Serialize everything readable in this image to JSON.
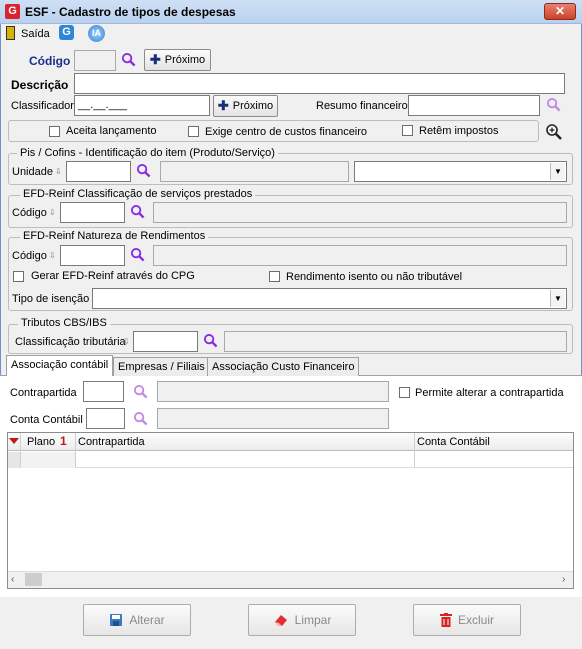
{
  "window": {
    "title": "ESF - Cadastro de tipos de despesas",
    "close": "✕"
  },
  "toolbar": {
    "exit_label": "Saída",
    "ia_label": "IA"
  },
  "form": {
    "codigo_label": "Código",
    "proximo_label": "Próximo",
    "descricao_label": "Descrição",
    "classificador_label": "Classificador",
    "classificador_value": "__.__.___",
    "resumo_label": "Resumo financeiro",
    "aceita_label": "Aceita lançamento",
    "exige_label": "Exige centro de custos financeiro",
    "retem_label": "Retêm impostos"
  },
  "pis": {
    "title": "Pis / Cofins - Identificação do item (Produto/Serviço)",
    "unidade_label": "Unidade"
  },
  "efd_class": {
    "title": "EFD-Reinf Classificação de serviços prestados",
    "codigo_label": "Código"
  },
  "efd_nat": {
    "title": "EFD-Reinf Natureza de Rendimentos",
    "codigo_label": "Código",
    "gerar_label": "Gerar EFD-Reinf através do CPG",
    "isento_label": "Rendimento isento ou não tributável",
    "tipo_label": "Tipo de isenção"
  },
  "cbs": {
    "title": "Tributos CBS/IBS",
    "classificacao_label": "Classificação tributária"
  },
  "tabs": [
    {
      "label": "Associação contábil"
    },
    {
      "label": "Empresas / Filiais"
    },
    {
      "label": "Associação Custo Financeiro"
    }
  ],
  "assoc": {
    "contrapartida_label": "Contrapartida",
    "permite_label": "Permite alterar a contrapartida",
    "conta_label": "Conta Contábil"
  },
  "grid": {
    "columns": [
      "Plano",
      "Contrapartida",
      "Conta Contábil"
    ]
  },
  "buttons": {
    "alterar": "Alterar",
    "limpar": "Limpar",
    "excluir": "Excluir"
  }
}
